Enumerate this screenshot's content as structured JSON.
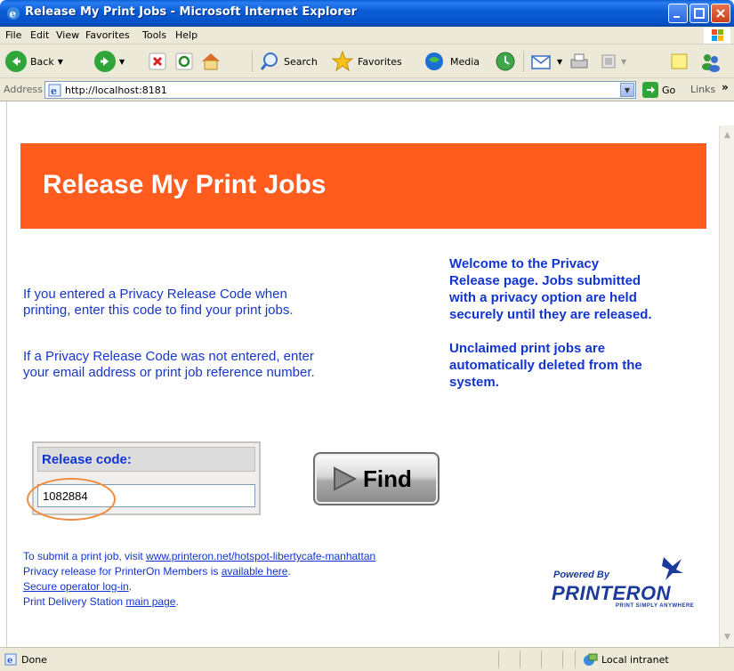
{
  "window": {
    "title": "Release My Print Jobs - Microsoft Internet Explorer"
  },
  "menu": [
    "File",
    "Edit",
    "View",
    "Favorites",
    "Tools",
    "Help"
  ],
  "toolbar": {
    "back_label": "Back",
    "search_label": "Search",
    "favorites_label": "Favorites",
    "media_label": "Media"
  },
  "address": {
    "label": "Address",
    "url": "http://localhost:8181",
    "go_label": "Go",
    "links_label": "Links"
  },
  "page": {
    "banner_title": "Release My Print Jobs",
    "instructions": [
      "If you entered a Privacy Release Code when",
      "printing, enter this code to find your print jobs.",
      "If a Privacy Release Code was not entered, enter",
      "your email address or print job reference number."
    ],
    "welcome": [
      "Welcome to the Privacy",
      "Release page. Jobs submitted",
      "with a privacy option are held",
      "securely until they are released.",
      "Unclaimed print jobs are",
      "automatically deleted from the",
      "system."
    ],
    "release_label": "Release code:",
    "release_value": "1082884",
    "find_label": "Find",
    "footer": {
      "line1_prefix": "To submit a print job, visit ",
      "line1_link": "www.printeron.net/hotspot-libertycafe-manhattan",
      "line2_prefix": "Privacy release for PrinterOn Members is ",
      "line2_link": "available here",
      "line2_suffix": ".",
      "line3_link": "Secure operator log-in",
      "line3_suffix": ".",
      "line4_prefix": "Print Delivery Station ",
      "line4_link": "main page",
      "line4_suffix": "."
    },
    "logo": {
      "powered": "Powered By",
      "brand": "PRINTERON",
      "tagline": "PRINT SIMPLY ANYWHERE"
    }
  },
  "status": {
    "text": "Done",
    "zone": "Local intranet"
  },
  "colors": {
    "banner": "#ff5c1e",
    "text_blue": "#1234d0",
    "highlight": "#f08a3c"
  }
}
